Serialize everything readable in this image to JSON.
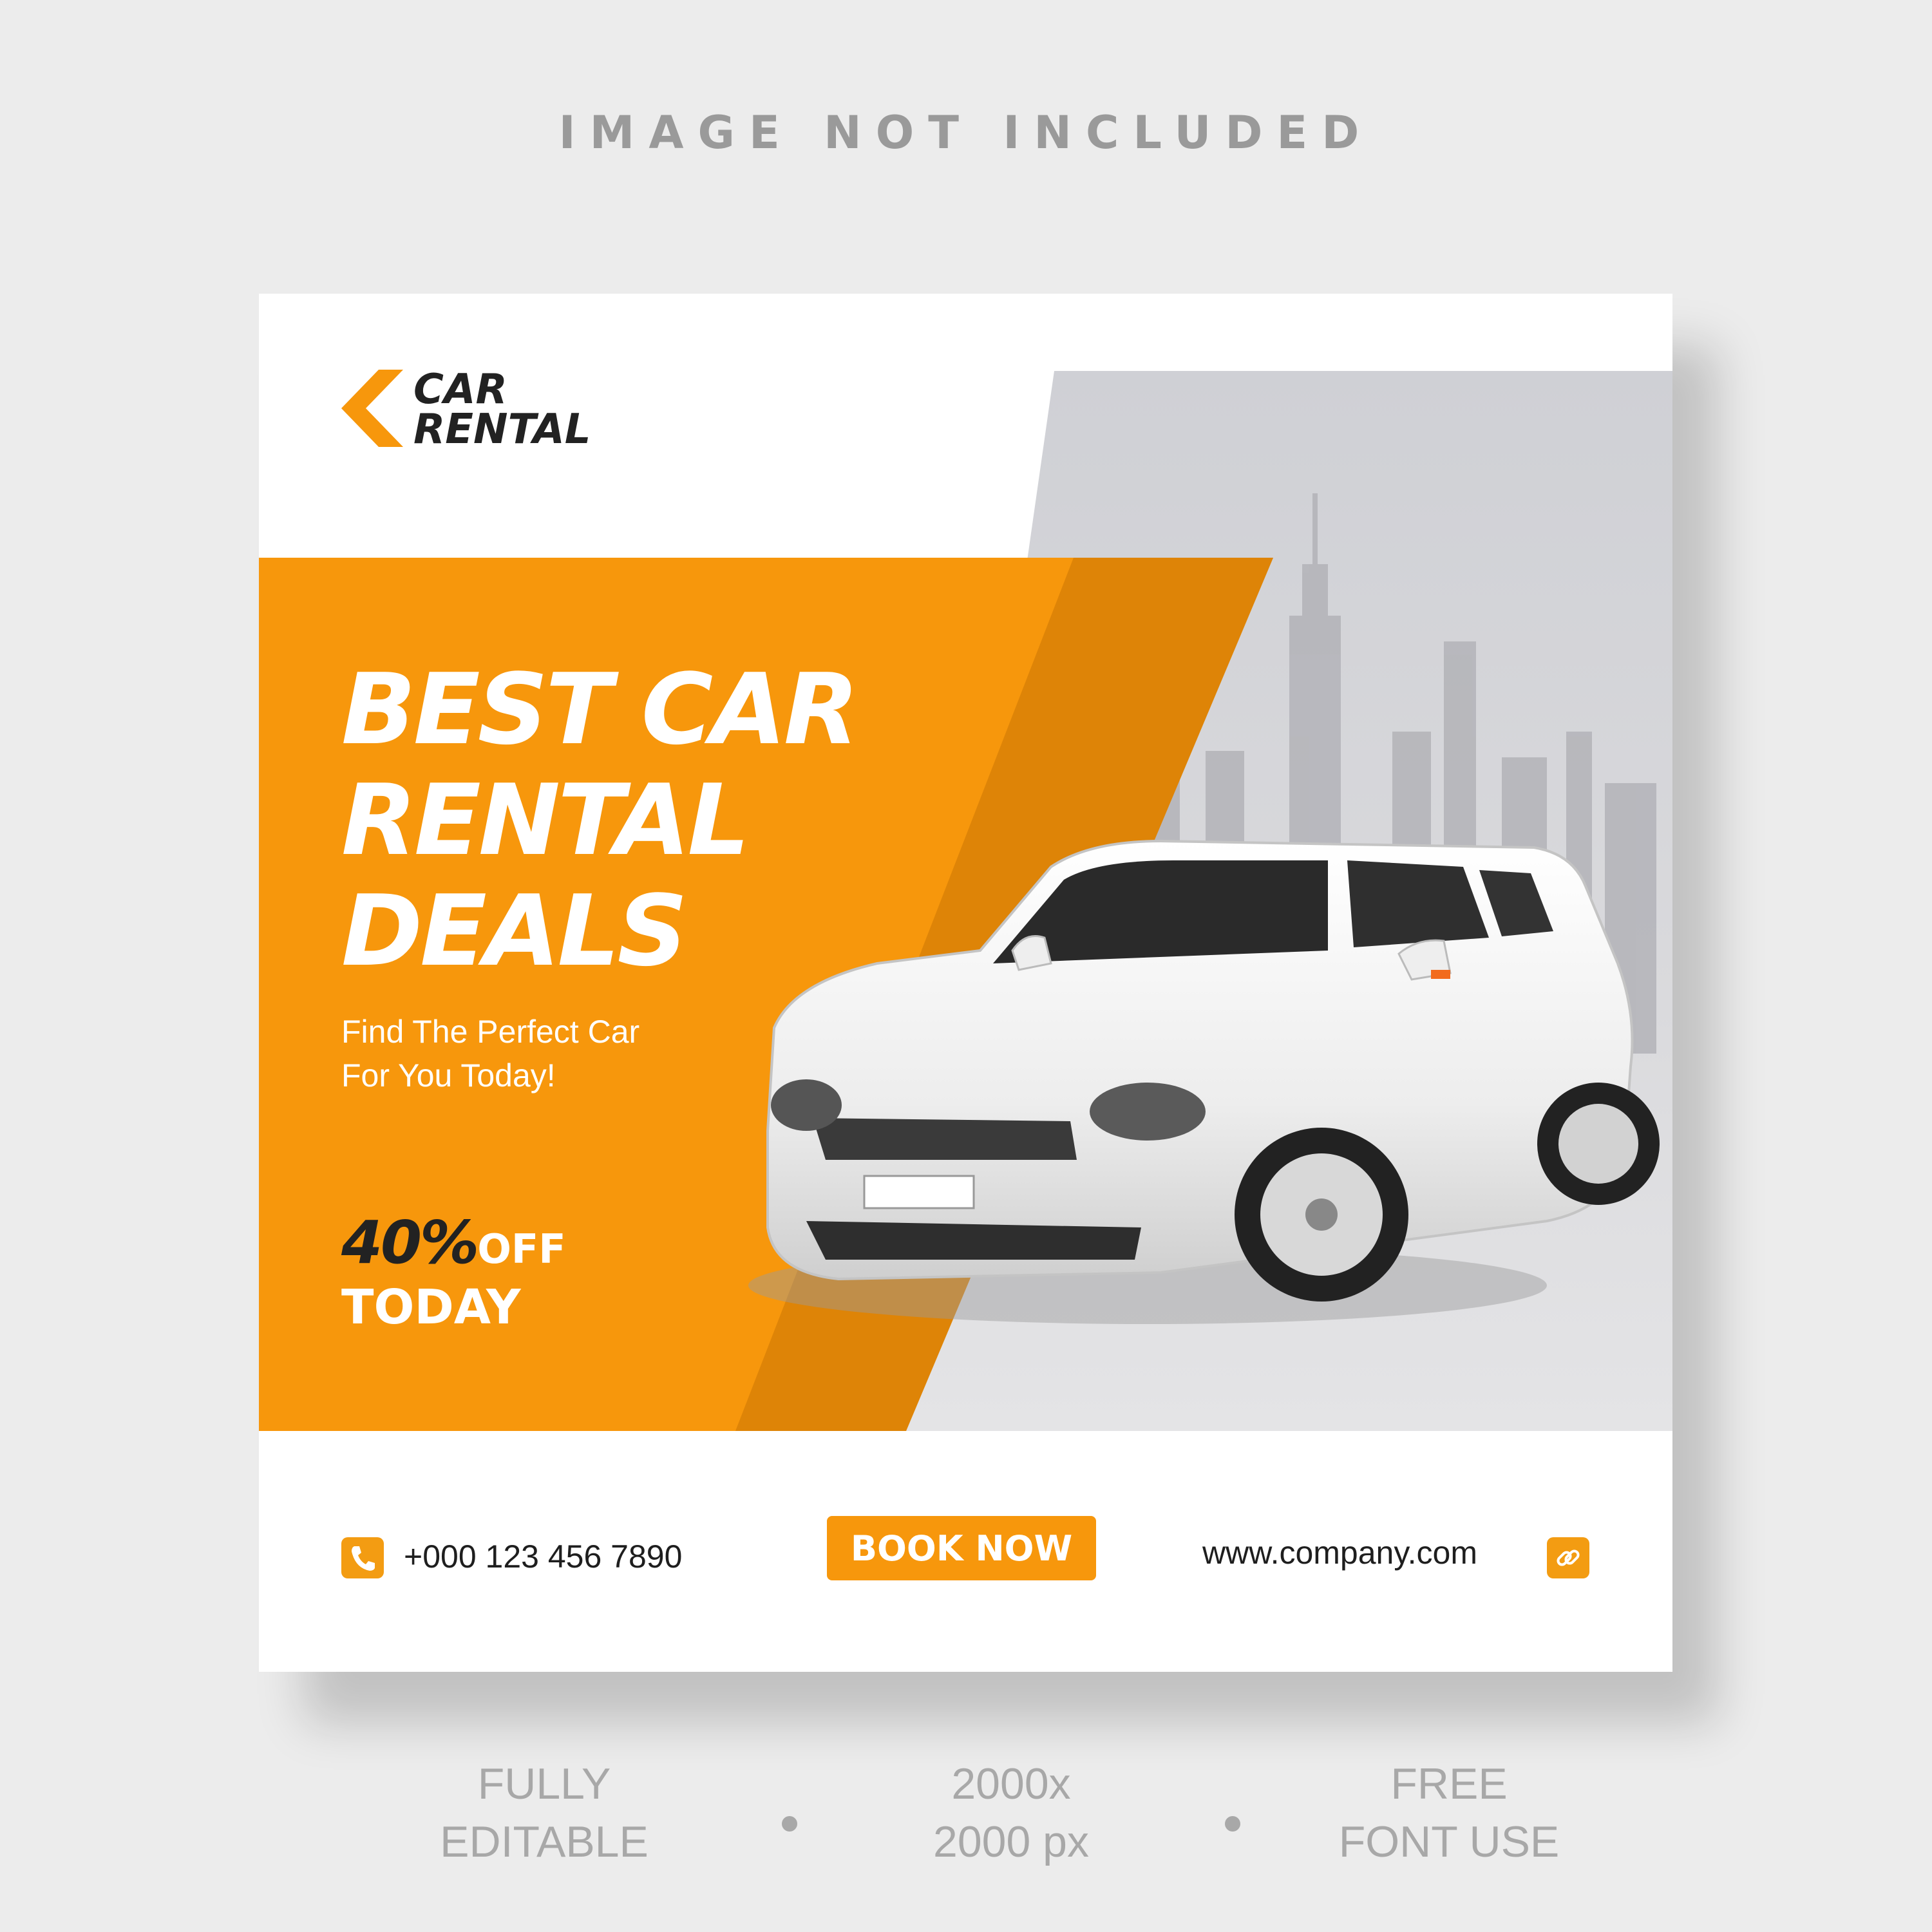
{
  "top_note": "IMAGE NOT INCLUDED",
  "brand": {
    "line1": "CAR",
    "line2": "RENTAL",
    "icon": "chevron-left-icon"
  },
  "headline": {
    "line1": "BEST CAR",
    "line2": "RENTAL",
    "line3": "DEALS"
  },
  "subtitle": {
    "line1": "Find The Perfect Car",
    "line2": "For You Today!"
  },
  "discount": {
    "percent": "40%",
    "off": "OFF",
    "today": "TODAY"
  },
  "contact": {
    "phone": "+000 123 456 7890",
    "phone_icon": "phone-icon",
    "book_label": "BOOK NOW",
    "website": "www.company.com",
    "link_icon": "link-icon"
  },
  "footer": {
    "item1": {
      "line1": "FULLY",
      "line2": "EDITABLE"
    },
    "item2": {
      "line1": "2000x",
      "line2": "2000 px"
    },
    "item3": {
      "line1": "FREE",
      "line2": "FONT USE"
    }
  },
  "colors": {
    "accent": "#f7970c",
    "accent_dark": "#d67d05",
    "text_dark": "#222222",
    "background": "#ececec"
  }
}
